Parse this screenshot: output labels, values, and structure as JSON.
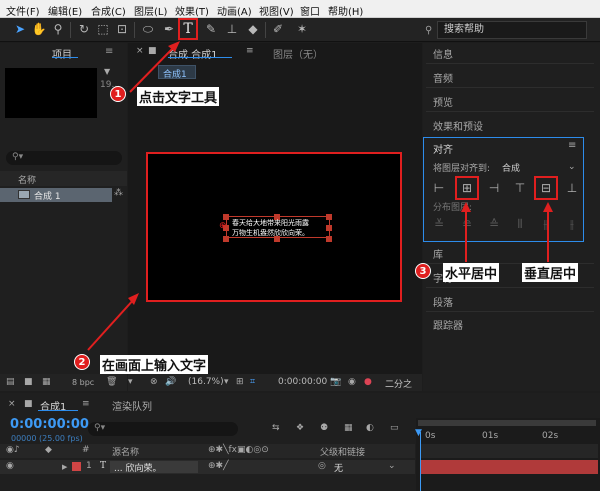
{
  "menubar": {
    "items": [
      "文件(F)",
      "编辑(E)",
      "合成(C)",
      "图层(L)",
      "效果(T)",
      "动画(A)",
      "视图(V)",
      "窗口",
      "帮助(H)"
    ]
  },
  "toolbar": {
    "search_placeholder": "搜索帮助",
    "tool_icons": [
      "selection-tool-icon",
      "hand-tool-icon",
      "zoom-tool-icon",
      "rotate-tool-icon",
      "camera-tool-icon",
      "pan-behind-tool-icon",
      "ellipse-tool-icon",
      "pen-tool-icon",
      "type-tool-icon",
      "brush-tool-icon",
      "clone-stamp-tool-icon",
      "eraser-tool-icon",
      "roto-brush-tool-icon",
      "puppet-pin-tool-icon"
    ]
  },
  "project": {
    "tab_label": "项目",
    "thumb_info": "19...",
    "col_name": "名称",
    "item_name": "合成 1",
    "bpc": "8 bpc"
  },
  "composition": {
    "tab_label": "合成 合成1",
    "layer_tab": "图层（无）",
    "comp_chip": "合成1",
    "canvas_text_lines": [
      "春天给大地带来阳光雨露",
      "万物生机盎然欣欣向荣。"
    ],
    "zoom": "(16.7%)",
    "timecode": "0:00:00:00",
    "resolution": "二分之"
  },
  "right_panels": {
    "items_top": [
      "信息",
      "音频",
      "预览",
      "效果和预设"
    ],
    "align": {
      "title": "对齐",
      "align_to_label": "将图层对齐到:",
      "align_to_value": "合成",
      "distribute_label": "分布图层:"
    },
    "items_bottom": [
      "库",
      "字符",
      "段落",
      "跟踪器"
    ]
  },
  "timeline": {
    "tab_label": "合成1",
    "render_queue": "渲染队列",
    "timecode": "0:00:00:00",
    "frame_info": "00000 (25.00 fps)",
    "col_source": "源名称",
    "col_parent": "父级和链接",
    "row_num": "1",
    "row_type": "T",
    "row_name": "... 欣向荣。",
    "row_parent": "无",
    "ruler": [
      "0s",
      "01s",
      "02s"
    ]
  },
  "annotations": {
    "step1": {
      "num": "1",
      "text": "点击文字工具"
    },
    "step2": {
      "num": "2",
      "text": "在画面上输入文字"
    },
    "step3": {
      "num": "3",
      "text": "水平居中"
    },
    "vertical": {
      "text": "垂直居中"
    }
  },
  "colors": {
    "accent_blue": "#2d8ceb",
    "annotation_red": "#e01f1f",
    "timeline_bar": "#b03a3a"
  }
}
